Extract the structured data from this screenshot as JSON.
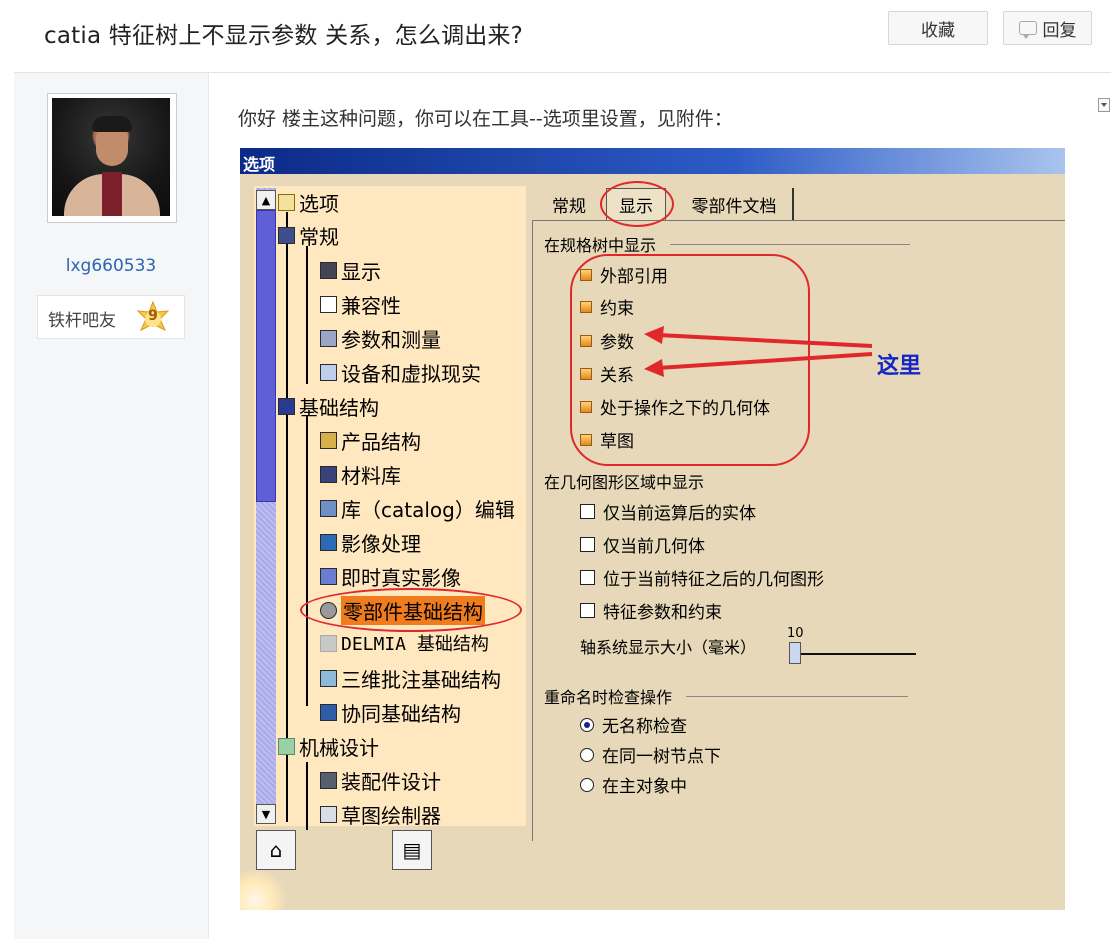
{
  "thread": {
    "title": "catia 特征树上不显示参数 关系，怎么调出来?",
    "favorite_label": "收藏",
    "reply_label": "回复"
  },
  "author": {
    "username": "lxg660533",
    "level_name": "铁杆吧友",
    "level_number": "9"
  },
  "post": {
    "text": "你好 楼主这种问题，你可以在工具--选项里设置，见附件："
  },
  "attachment": {
    "window_title": "选项",
    "tree": {
      "root": "选项",
      "items": [
        {
          "label": "常规"
        },
        {
          "label": "显示"
        },
        {
          "label": "兼容性"
        },
        {
          "label": "参数和测量"
        },
        {
          "label": "设备和虚拟现实"
        },
        {
          "label": "基础结构"
        },
        {
          "label": "产品结构"
        },
        {
          "label": "材料库"
        },
        {
          "label": "库（catalog）编辑"
        },
        {
          "label": "影像处理"
        },
        {
          "label": "即时真实影像"
        },
        {
          "label": "零部件基础结构"
        },
        {
          "label": "DELMIA 基础结构"
        },
        {
          "label": "三维批注基础结构"
        },
        {
          "label": "协同基础结构"
        },
        {
          "label": "机械设计"
        },
        {
          "label": "装配件设计"
        },
        {
          "label": "草图绘制器"
        }
      ],
      "selected": "零部件基础结构"
    },
    "tabs": [
      "常规",
      "显示",
      "零部件文档"
    ],
    "active_tab": "显示",
    "spec_tree_group": {
      "title": "在规格树中显示",
      "options": [
        "外部引用",
        "约束",
        "参数",
        "关系",
        "处于操作之下的几何体",
        "草图"
      ]
    },
    "geometry_group": {
      "title": "在几何图形区域中显示",
      "options": [
        "仅当前运算后的实体",
        "仅当前几何体",
        "位于当前特征之后的几何图形",
        "特征参数和约束"
      ]
    },
    "axis_size": {
      "label": "轴系统显示大小（毫米）",
      "value": "10"
    },
    "rename_group": {
      "title": "重命名时检查操作",
      "options": [
        "无名称检查",
        "在同一树节点下",
        "在主对象中"
      ],
      "selected": "无名称检查"
    },
    "annotation_text": "这里",
    "annotation_color": "#1426c8",
    "highlight_color": "#e0282c"
  }
}
